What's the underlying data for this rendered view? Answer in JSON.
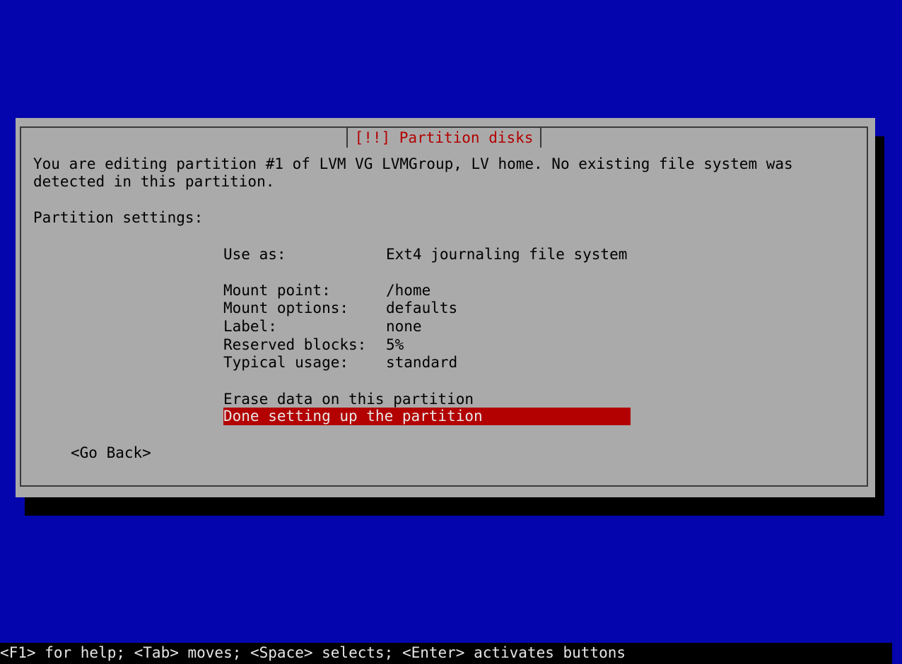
{
  "dialog": {
    "title": "[!!] Partition disks",
    "message_line1": "You are editing partition #1 of LVM VG LVMGroup, LV home. No existing file system was",
    "message_line2": "detected in this partition.",
    "section_label": "Partition settings:",
    "settings": [
      {
        "label": "Use as:",
        "value": "Ext4 journaling file system"
      },
      {
        "label": "Mount point:",
        "value": "/home"
      },
      {
        "label": "Mount options:",
        "value": "defaults"
      },
      {
        "label": "Label:",
        "value": "none"
      },
      {
        "label": "Reserved blocks:",
        "value": "5%"
      },
      {
        "label": "Typical usage:",
        "value": "standard"
      }
    ],
    "actions": [
      {
        "label": "Erase data on this partition",
        "selected": false
      },
      {
        "label": "Done setting up the partition",
        "selected": true
      }
    ],
    "go_back_label": "<Go Back>"
  },
  "footer": {
    "help_text": "<F1> for help; <Tab> moves; <Space> selects; <Enter> activates buttons"
  },
  "colors": {
    "background": "#0505ad",
    "dialog": "#aaaaaa",
    "title_text": "#b30000",
    "selection": "#b30000"
  }
}
